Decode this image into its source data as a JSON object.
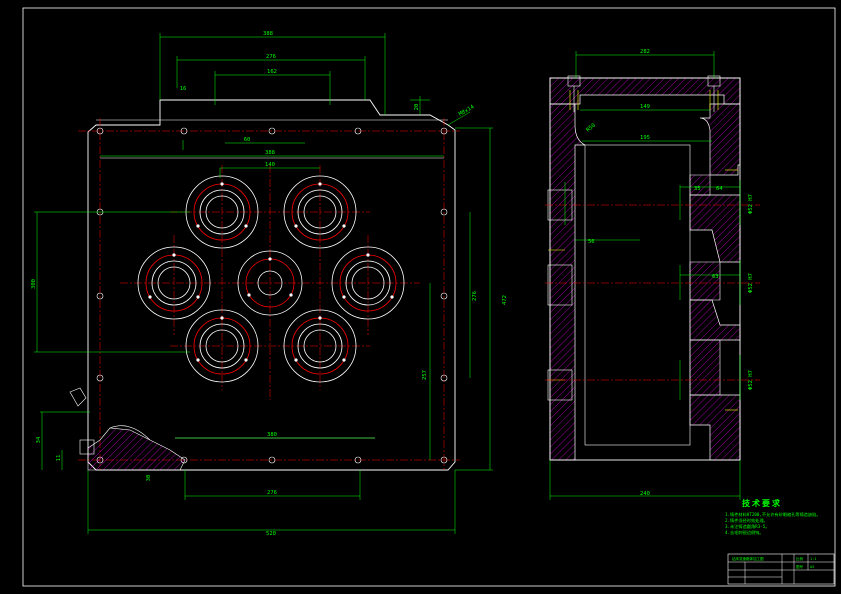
{
  "left_view": {
    "dims": {
      "top_overall": "388",
      "top_mid": "276",
      "top_inner": "162",
      "top_small": "60",
      "top_step": "16",
      "row_top": "388",
      "hole_gap": "140",
      "left_span": "300",
      "right_inner": "276",
      "right_overall": "472",
      "right_lower": "257",
      "inner_bottom": "380",
      "bottom_mid": "276",
      "bottom_overall": "520",
      "left_small_a": "34",
      "left_small_b": "30",
      "left_small_c": "11",
      "right_tiny": "20"
    },
    "callout": "M8x14"
  },
  "right_view": {
    "dims": {
      "top": "282",
      "inner_a": "149",
      "inner_b": "195",
      "angle": "R50",
      "mid_left": "56",
      "bore_top_a": "64",
      "bore_top_b": "35",
      "bore_mid": "63",
      "bottom": "240",
      "bore_ref_1": "Φ52 H7",
      "bore_ref_2": "Φ52 H7",
      "bore_ref_3": "Φ52 H7"
    }
  },
  "tech_notes": {
    "title": "技术要求",
    "lines": [
      "1.铸件材料HT200,不允许有砂眼缩孔等铸造缺陷。",
      "2.铸件须经时效处理。",
      "3.未注铸造圆角R3-5。",
      "4.去毛刺锐边倒钝。"
    ]
  },
  "title_block": {
    "name": "钻床变速箱体加工图",
    "cells": [
      "比例",
      "1:1",
      "图号",
      "A3"
    ]
  },
  "colors": {
    "outline": "#ffffff",
    "dimension": "#00ff00",
    "center": "#ff0000",
    "hatch": "#ff00ff",
    "hidden": "#ffff00",
    "gear": "#ff0000"
  }
}
